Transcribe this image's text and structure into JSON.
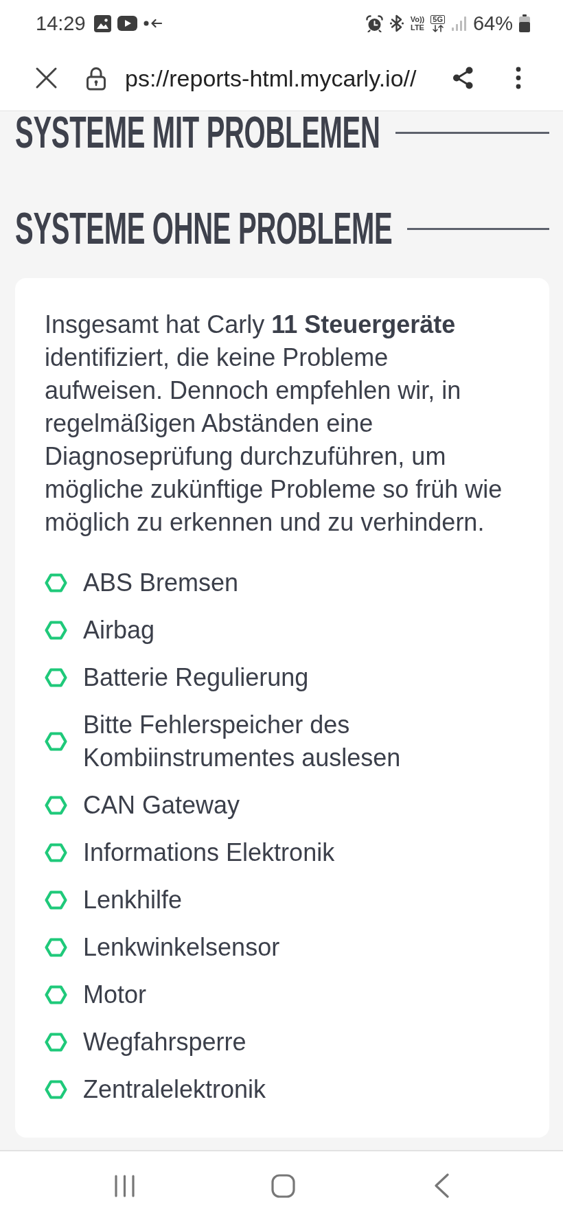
{
  "status_bar": {
    "time": "14:29",
    "volte": [
      "Vo))",
      "LTE"
    ],
    "network": "5G",
    "battery": "64%"
  },
  "toolbar": {
    "url": "ps://reports-html.mycarly.io//"
  },
  "sections": [
    {
      "title": "SYSTEME MIT PROBLEMEN"
    },
    {
      "title": "SYSTEME OHNE PROBLEME",
      "summary": "Insgesamt hat Carly **11 Steuergeräte** identifiziert, die keine Probleme aufweisen. Dennoch empfehlen wir, in regelmäßigen Abständen eine Diagnoseprüfung durchzuführen, um mögliche zukünftige Probleme so früh wie möglich zu erkennen und zu verhindern.",
      "systems": [
        "ABS Bremsen",
        "Airbag",
        "Batterie Regulierung",
        "Bitte Fehlerspeicher des Kombiinstrumentes auslesen",
        "CAN Gateway",
        "Informations Elektronik",
        "Lenkhilfe",
        "Lenkwinkelsensor",
        "Motor",
        "Wegfahrsperre",
        "Zentralelektronik"
      ]
    }
  ]
}
